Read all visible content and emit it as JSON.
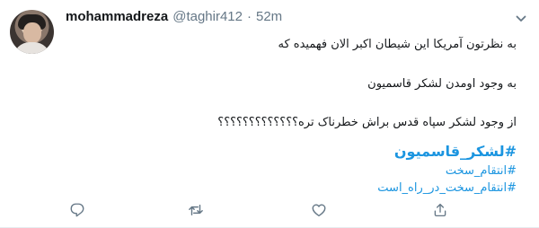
{
  "tweet": {
    "display_name": "mohammadreza",
    "username": "@taghir412",
    "separator": "·",
    "time": "52m",
    "lines": [
      "به نظرتون آمریکا این شیطان اکبر الان فهمیده که",
      "به وجود اومدن لشکر قاسمیون",
      "از وجود لشکر سپاه قدس براش خطرناک تره؟؟؟؟؟؟؟؟؟؟؟؟؟"
    ],
    "hashtags": [
      "#لشکر_قاسمیون",
      "#انتقام_سخت",
      "#انتقام_سخت_در_راه_است"
    ]
  },
  "actions": [
    {
      "icon": "reply-icon"
    },
    {
      "icon": "retweet-icon"
    },
    {
      "icon": "like-icon"
    },
    {
      "icon": "share-icon"
    }
  ],
  "colors": {
    "text": "#14171a",
    "muted": "#657786",
    "link": "#1b95e0",
    "border": "#e6ecf0"
  }
}
